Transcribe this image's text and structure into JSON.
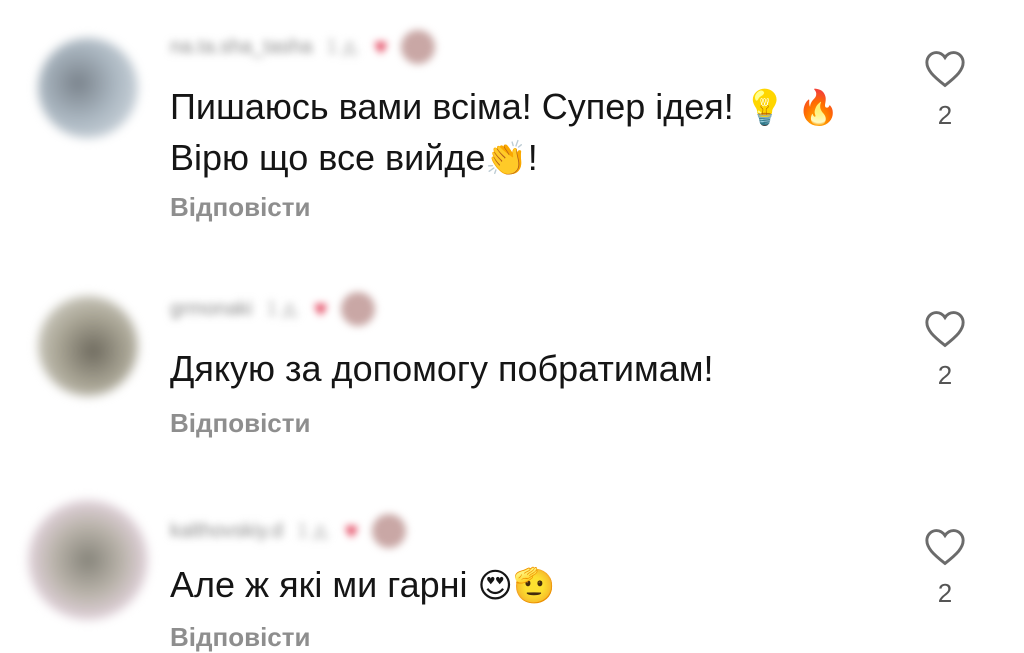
{
  "comments": [
    {
      "username": "na.ta.sha_tasha",
      "time": "1 д.",
      "text_line1": "Пишаюсь вами всіма! Супер ідея! ",
      "emoji_line1": "💡 🔥",
      "text_line2": "Вірю що все вийде",
      "emoji_line2": "👏",
      "text_line2_end": "!",
      "reply_label": "Відповісти",
      "like_count": "2",
      "avatar_colors": [
        "#a8b2bd",
        "#6f7a85"
      ]
    },
    {
      "username": "grmonaki",
      "time": "1 д.",
      "text_line1": "Дякую за допомогу побратимам!",
      "reply_label": "Відповісти",
      "like_count": "2",
      "avatar_colors": [
        "#b8b4a6",
        "#7d7a70"
      ]
    },
    {
      "username": "kalthovskiy.d",
      "time": "1 д.",
      "text_line1": "Але ж які ми гарні ",
      "emoji_line1": "😍🫡",
      "reply_label": "Відповісти",
      "like_count": "2",
      "avatar_colors": [
        "#d9c7d6",
        "#8c8a84"
      ]
    }
  ],
  "colors": {
    "accent_heart": "#e0314d",
    "secondary_text": "#8e8e8e"
  },
  "icons": {
    "like": "heart-outline-icon",
    "liked_by_author": "heart-filled-icon"
  }
}
